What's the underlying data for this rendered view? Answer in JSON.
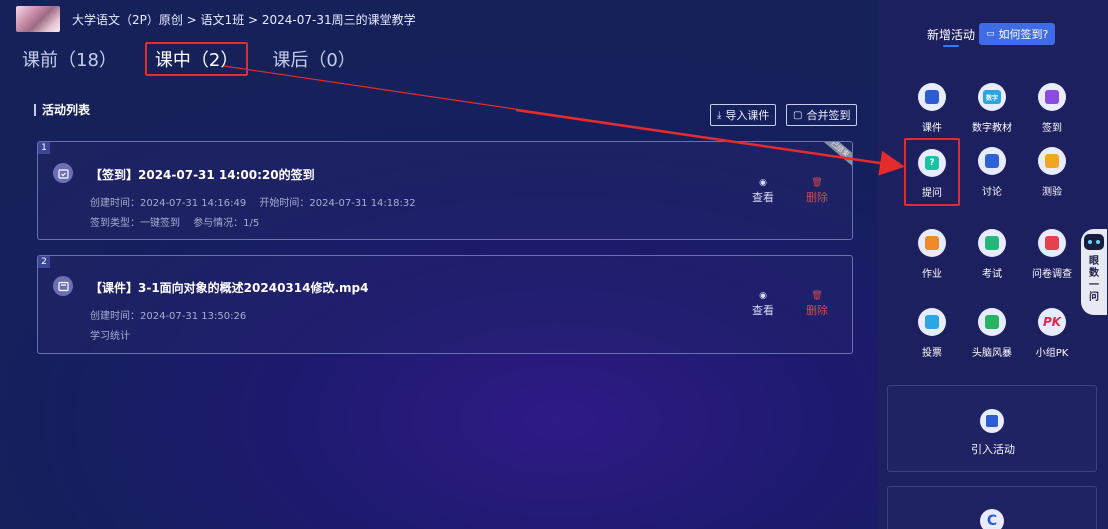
{
  "breadcrumb": {
    "text": "大学语文（2P）原创 > 语文1班 > 2024-07-31周三的课堂教学"
  },
  "tabs": [
    {
      "label": "课前（18）"
    },
    {
      "label": "课中（2）"
    },
    {
      "label": "课后（0）"
    }
  ],
  "activity_list": {
    "title": "活动列表",
    "import_label": "导入课件",
    "merge_label": "合并签到"
  },
  "cards": [
    {
      "index": "1",
      "title": "【签到】2024-07-31 14:00:20的签到",
      "created": "创建时间：2024-07-31 14:16:49",
      "started": "开始时间：2024-07-31 14:18:32",
      "type": "签到类型：一键签到",
      "participation": "参与情况：1/5",
      "view_label": "查看",
      "delete_label": "删除",
      "ribbon": "已结束"
    },
    {
      "index": "2",
      "title": "【课件】3-1面向对象的概述20240314修改.mp4",
      "created": "创建时间：2024-07-31 13:50:26",
      "stats": "学习统计",
      "view_label": "查看",
      "delete_label": "删除"
    }
  ],
  "panel": {
    "header": "新增活动",
    "how_label": "如何签到?",
    "tools": [
      {
        "label": "课件",
        "icon": "courseware-icon",
        "color": "#2d5bd6"
      },
      {
        "label": "数字教材",
        "icon": "digital-textbook-icon",
        "color": "#2aa6e6",
        "glyph": "数字"
      },
      {
        "label": "签到",
        "icon": "checkin-icon",
        "color": "#8a4be0"
      },
      {
        "label": "提问",
        "icon": "question-icon",
        "color": "#18c3a2",
        "glyph": "?"
      },
      {
        "label": "讨论",
        "icon": "discussion-icon",
        "color": "#2e63d8"
      },
      {
        "label": "测验",
        "icon": "quiz-icon",
        "color": "#f2a720"
      },
      {
        "label": "作业",
        "icon": "homework-icon",
        "color": "#f08a28"
      },
      {
        "label": "考试",
        "icon": "exam-icon",
        "color": "#24b67a"
      },
      {
        "label": "问卷调查",
        "icon": "survey-icon",
        "color": "#e8404c"
      },
      {
        "label": "投票",
        "icon": "vote-icon",
        "color": "#2aa6e6"
      },
      {
        "label": "头脑风暴",
        "icon": "brainstorm-icon",
        "color": "#27b35f"
      },
      {
        "label": "小组PK",
        "icon": "group-pk-icon",
        "color": "#e8264c",
        "glyph": "PK"
      }
    ],
    "import_activity_label": "引入活动",
    "second_box_glyph": "C"
  },
  "assistant": {
    "text": "眼数一问"
  },
  "colors": {
    "highlight_red": "#e52b2b",
    "accent_blue": "#3e6ce6"
  }
}
